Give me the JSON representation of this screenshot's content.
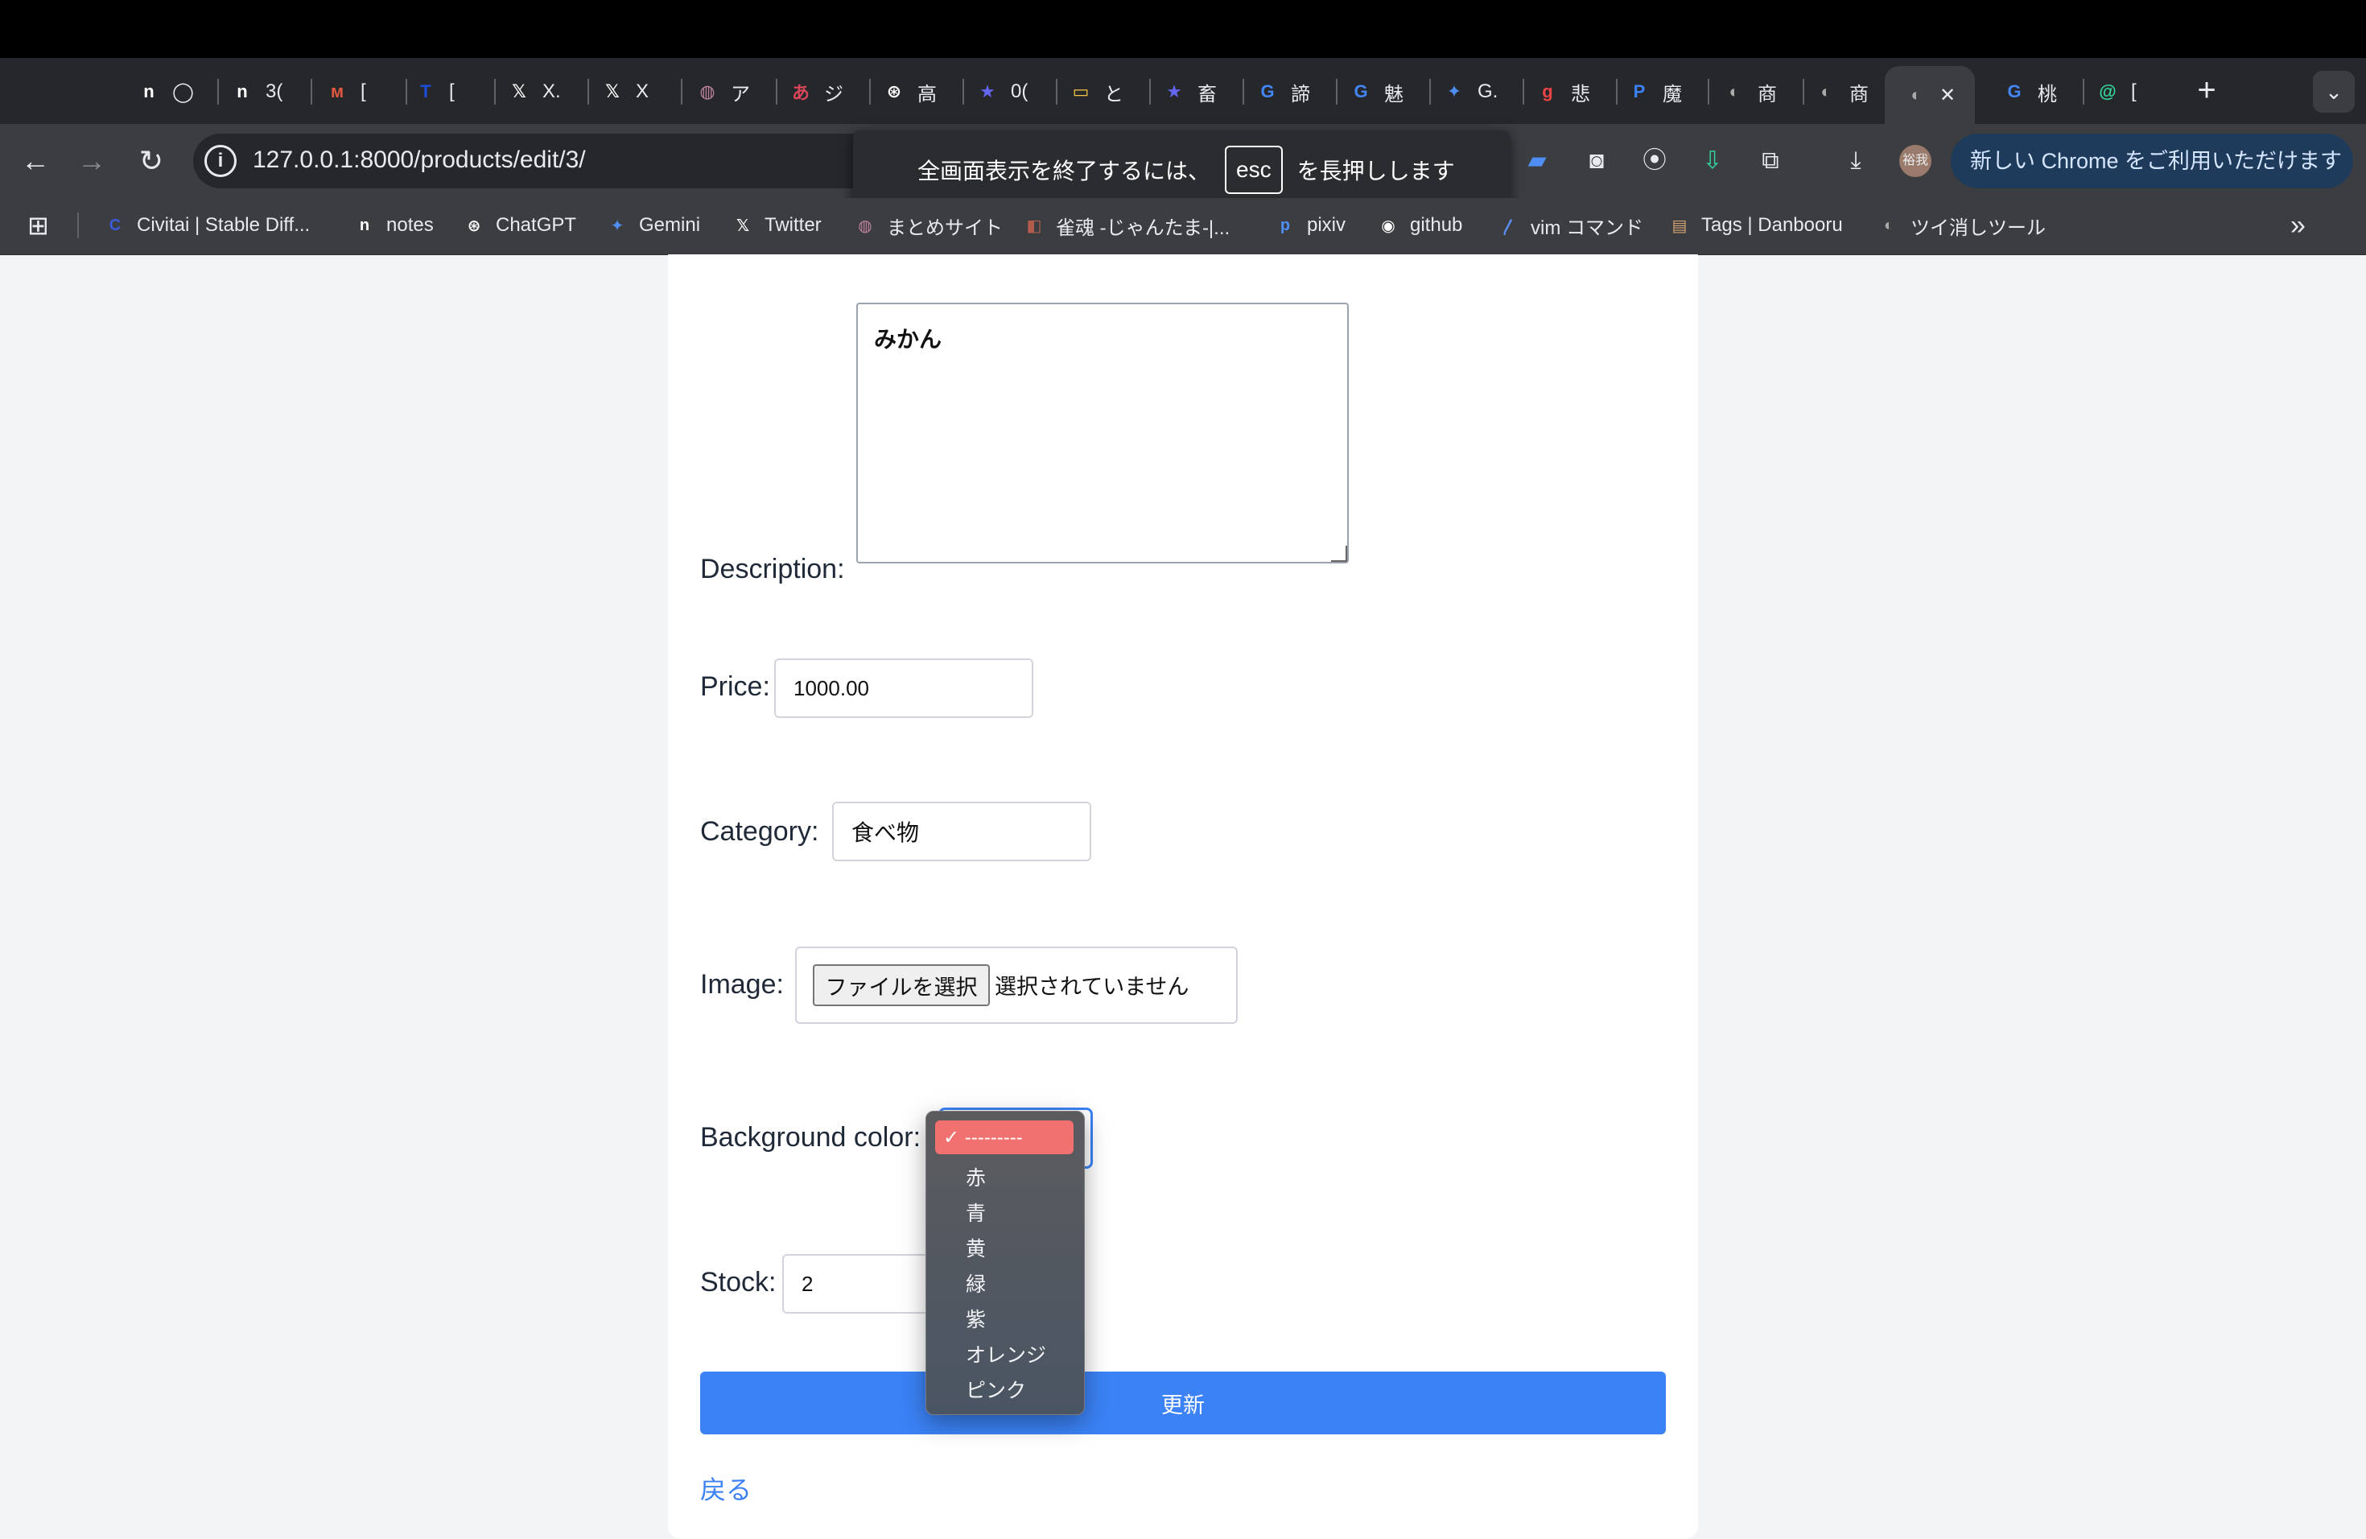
{
  "browser": {
    "tabs": [
      {
        "icon": "n",
        "label": "◯"
      },
      {
        "icon": "n",
        "label": "3("
      },
      {
        "icon": "ᴍ",
        "label": "["
      },
      {
        "icon": "T",
        "label": "["
      },
      {
        "icon": "𝕏",
        "label": "X."
      },
      {
        "icon": "𝕏",
        "label": "X"
      },
      {
        "icon": "◍",
        "label": "ア"
      },
      {
        "icon": "あ",
        "label": "ジ"
      },
      {
        "icon": "⊛",
        "label": "高"
      },
      {
        "icon": "★",
        "label": "0("
      },
      {
        "icon": "▭",
        "label": "と"
      },
      {
        "icon": "★",
        "label": "畜"
      },
      {
        "icon": "G",
        "label": "諦"
      },
      {
        "icon": "G",
        "label": "魅"
      },
      {
        "icon": "✦",
        "label": "G."
      },
      {
        "icon": "g",
        "label": "悲"
      },
      {
        "icon": "P",
        "label": "魔"
      },
      {
        "icon": "◐",
        "label": "商"
      },
      {
        "icon": "◐",
        "label": "商"
      },
      {
        "icon": "◐",
        "label": "✕"
      },
      {
        "icon": "G",
        "label": "桃"
      },
      {
        "icon": "@",
        "label": "["
      }
    ],
    "new_tab": "+",
    "tab_menu": "⌄",
    "url": "127.0.0.1:8000/products/edit/3/",
    "update_pill": "新しい Chrome をご利用いただけます  ⋮",
    "toast": {
      "before": "全画面表示を終了するには、",
      "key": "esc",
      "after": "を長押しします"
    },
    "bookmarks": [
      {
        "icon": "C",
        "label": "Civitai | Stable Diff..."
      },
      {
        "icon": "n",
        "label": "notes"
      },
      {
        "icon": "⊛",
        "label": "ChatGPT"
      },
      {
        "icon": "✦",
        "label": "Gemini"
      },
      {
        "icon": "𝕏",
        "label": "Twitter"
      },
      {
        "icon": "◍",
        "label": "まとめサイト"
      },
      {
        "icon": "◧",
        "label": "雀魂 -じゃんたま-|..."
      },
      {
        "icon": "p",
        "label": "pixiv"
      },
      {
        "icon": "◉",
        "label": "github"
      },
      {
        "icon": "〳",
        "label": "vim コマンド"
      },
      {
        "icon": "▤",
        "label": "Tags | Danbooru"
      },
      {
        "icon": "◐",
        "label": "ツイ消しツール"
      }
    ],
    "bookmarks_more": "»"
  },
  "form": {
    "description_label": "Description:",
    "description_value": "みかん",
    "price_label": "Price:",
    "price_value": "1000.00",
    "category_label": "Category:",
    "category_value": "食べ物",
    "image_label": "Image:",
    "file_button": "ファイルを選択",
    "file_status": "選択されていません",
    "bgcolor_label": "Background color:",
    "bgcolor_selected": "✓ ---------",
    "bgcolor_options": [
      "赤",
      "青",
      "黄",
      "緑",
      "紫",
      "オレンジ",
      "ピンク"
    ],
    "stock_label": "Stock:",
    "stock_value": "2",
    "submit_label": "更新",
    "back_label": "戻る"
  }
}
